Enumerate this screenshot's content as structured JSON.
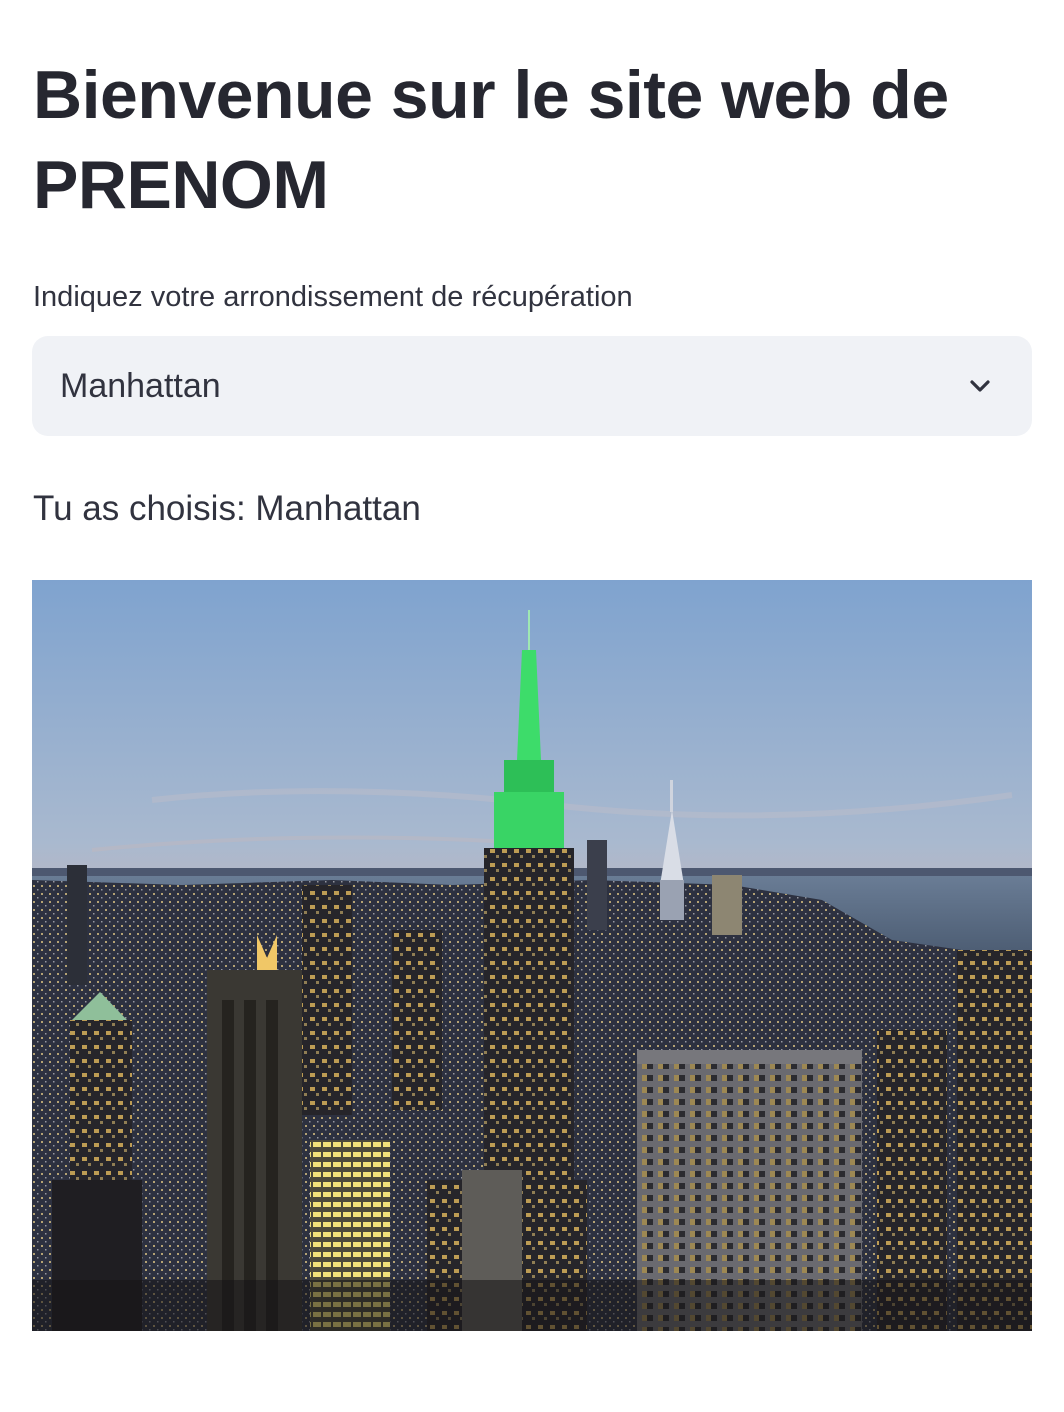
{
  "header": {
    "title": "Bienvenue sur le site web de PRENOM"
  },
  "borough_select": {
    "label": "Indiquez votre arrondissement de récupération",
    "selected_value": "Manhattan",
    "icon": "chevron-down-icon"
  },
  "result": {
    "text": "Tu as choisis: Manhattan"
  },
  "image": {
    "subject": "manhattan-skyline-image"
  },
  "colors": {
    "title": "#262730",
    "text": "#31333f",
    "select_background": "#f0f2f6",
    "spire_green": "#3ddc6a"
  }
}
